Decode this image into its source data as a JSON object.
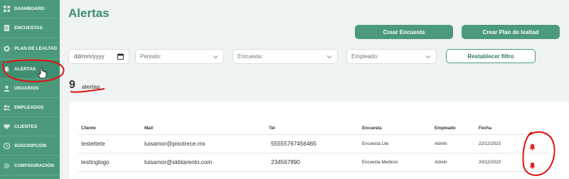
{
  "sidebar": {
    "items": [
      {
        "label": "DASHBOARD",
        "icon": "dashboard-icon"
      },
      {
        "label": "ENCUESTAS",
        "icon": "survey-icon"
      },
      {
        "label": "PLAN DE LEALTAD",
        "icon": "loyalty-plan-icon"
      },
      {
        "label": "ALERTAS",
        "icon": "bell-icon"
      },
      {
        "label": "USUARIOS",
        "icon": "user-icon"
      },
      {
        "label": "EMPLEADOS",
        "icon": "employees-icon"
      },
      {
        "label": "CLIENTES",
        "icon": "heart-icon"
      },
      {
        "label": "SUSCRIPCIÓN",
        "icon": "subscription-icon"
      },
      {
        "label": "CONFIGURACIÓN",
        "icon": "gear-icon"
      }
    ]
  },
  "page": {
    "title": "Alertas"
  },
  "actions": {
    "create_survey": "Crear Encuesta",
    "create_loyalty_plan": "Crear Plan de lealtad",
    "reset_filter": "Restablecer filtro"
  },
  "filters": {
    "date_placeholder": "dd/mm/yyyy",
    "period_placeholder": "Periodo:",
    "survey_placeholder": "Encuesta:",
    "employee_placeholder": "Empleado:"
  },
  "summary": {
    "count": "9",
    "count_label": "alertas"
  },
  "table": {
    "headers": [
      "Cliente",
      "Mail",
      "Tel",
      "Encuesta",
      "Empleado",
      "Fecha"
    ],
    "rows": [
      {
        "cliente": "testettete",
        "mail": "luisamor@pisotrece.mx",
        "tel": "55555767456465",
        "encuesta": "Encuesta Lite",
        "empleado": "Admin",
        "fecha": "22/12/2023"
      },
      {
        "cliente": "testinglogo",
        "mail": "luisamor@skbtarento.com",
        "tel": "234567890",
        "encuesta": "Encuesta Medicos",
        "empleado": "Admin",
        "fecha": "20/12/2023"
      }
    ]
  },
  "colors": {
    "sidebar": "#4a9a7b",
    "accent": "#3a8d6c",
    "alert_bell": "#e02020",
    "annotation": "#e01010"
  }
}
